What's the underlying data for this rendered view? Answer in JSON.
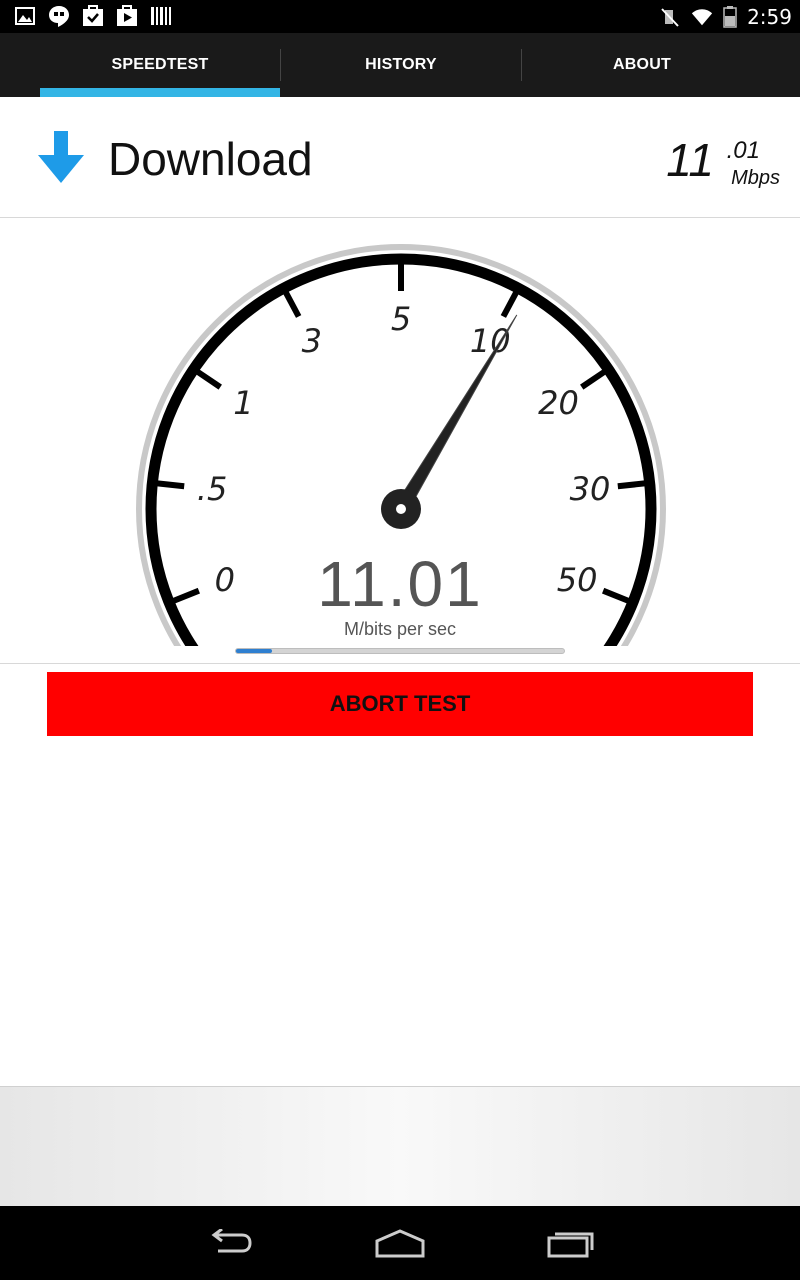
{
  "status_bar": {
    "time": "2:59",
    "left_icons": [
      "gallery-icon",
      "hangouts-icon",
      "tasks-icon",
      "play-store-icon",
      "barcode-icon"
    ],
    "right_icons": [
      "mute-icon",
      "wifi-icon",
      "battery-icon"
    ]
  },
  "tabs": [
    {
      "label": "SPEEDTEST",
      "active": true
    },
    {
      "label": "HISTORY",
      "active": false
    },
    {
      "label": "ABOUT",
      "active": false
    }
  ],
  "download": {
    "title": "Download",
    "speed_integer": "11",
    "speed_decimal": ".01",
    "unit": "Mbps",
    "arrow_color": "#1e9be8"
  },
  "gauge": {
    "scale_labels": [
      "0",
      ".5",
      "1",
      "3",
      "5",
      "10",
      "20",
      "30",
      "50"
    ],
    "reading": "11.01",
    "unit_label": "M/bits per sec",
    "needle_value": "11.01",
    "progress_fraction": 0.11
  },
  "abort_button": {
    "label": "ABORT TEST",
    "color": "#ff0000"
  },
  "nav": {
    "back": "back-icon",
    "home": "home-icon",
    "recents": "recents-icon"
  },
  "colors": {
    "tab_indicator": "#33b5e5",
    "tab_bar": "#1a1a1a"
  }
}
